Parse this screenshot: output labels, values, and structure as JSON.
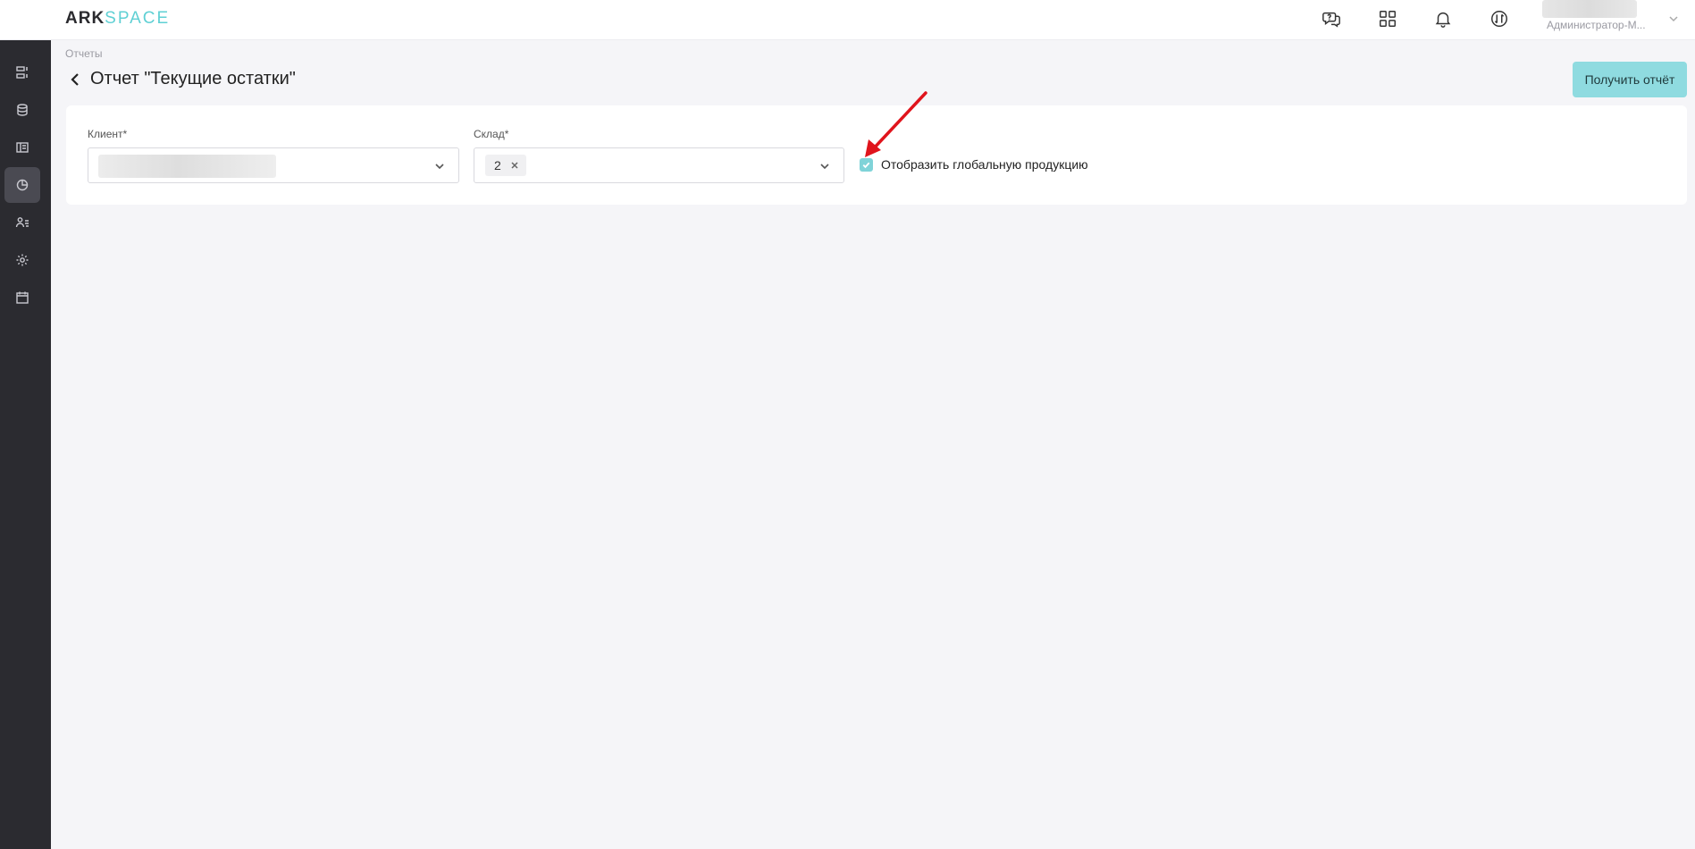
{
  "app": {
    "logo_bold": "ARK",
    "logo_light": "SPACE",
    "accent_color": "#7fd3d8"
  },
  "header": {
    "icons": [
      "support-chat-icon",
      "apps-grid-icon",
      "bell-icon",
      "sync-icon"
    ],
    "user_role": "Администратор-М..."
  },
  "sidebar": {
    "items": [
      {
        "icon": "list-icon",
        "active": false
      },
      {
        "icon": "database-icon",
        "active": false
      },
      {
        "icon": "layout-icon",
        "active": false
      },
      {
        "icon": "reports-pie-icon",
        "active": true
      },
      {
        "icon": "users-icon",
        "active": false
      },
      {
        "icon": "gear-icon",
        "active": false
      },
      {
        "icon": "calendar-icon",
        "active": false
      }
    ]
  },
  "page": {
    "breadcrumb": "Отчеты",
    "title": "Отчет \"Текущие остатки\"",
    "get_report_label": "Получить отчёт"
  },
  "filters": {
    "client_label": "Клиент*",
    "warehouse_label": "Склад*",
    "warehouse_tags": [
      "2"
    ],
    "global_products_label": "Отобразить глобальную продукцию",
    "global_products_checked": true
  }
}
